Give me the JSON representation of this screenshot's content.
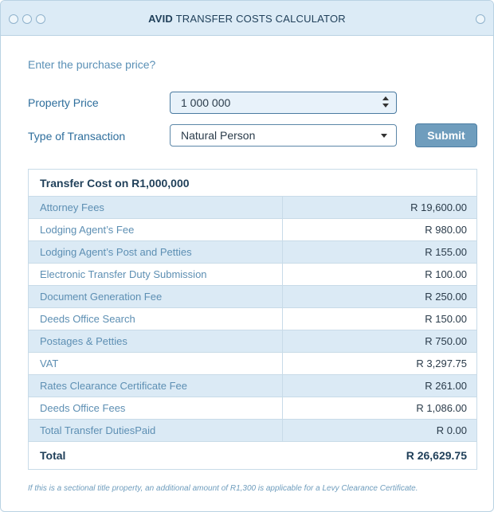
{
  "window": {
    "title_bold": "AVID",
    "title_rest": " TRANSFER COSTS CALCULATOR"
  },
  "form": {
    "prompt": "Enter the purchase price?",
    "price_label": "Property Price",
    "price_value": "1 000 000",
    "transaction_label": "Type of Transaction",
    "transaction_value": "Natural Person",
    "submit_label": "Submit"
  },
  "table": {
    "header": "Transfer Cost on R1,000,000",
    "rows": [
      {
        "label": "Attorney Fees",
        "amount": "R 19,600.00"
      },
      {
        "label": "Lodging Agent’s Fee",
        "amount": "R 980.00"
      },
      {
        "label": "Lodging Agent’s Post and Petties",
        "amount": "R 155.00"
      },
      {
        "label": "Electronic Transfer Duty Submission",
        "amount": "R 100.00"
      },
      {
        "label": "Document Generation Fee",
        "amount": "R 250.00"
      },
      {
        "label": "Deeds Office Search",
        "amount": "R 150.00"
      },
      {
        "label": "Postages & Petties",
        "amount": "R 750.00"
      },
      {
        "label": "VAT",
        "amount": "R 3,297.75"
      },
      {
        "label": "Rates Clearance Certificate Fee",
        "amount": "R 261.00"
      },
      {
        "label": "Deeds Office Fees",
        "amount": "R 1,086.00"
      },
      {
        "label": "Total Transfer DutiesPaid",
        "amount": "R 0.00"
      }
    ],
    "total_label": "Total",
    "total_amount": "R 26,629.75"
  },
  "footnote": "If this is a sectional title property, an additional amount of R1,300 is applicable for a Levy Clearance Certificate."
}
